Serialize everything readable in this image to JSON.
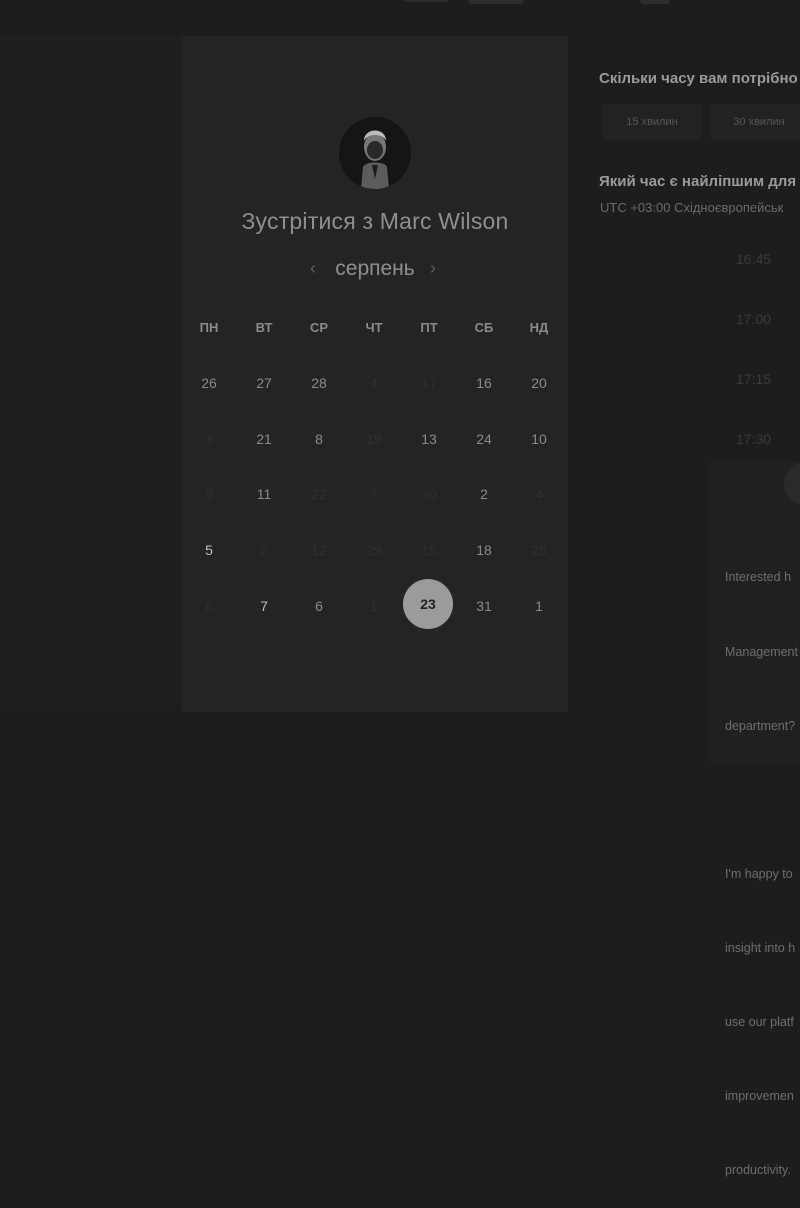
{
  "scheduler": {
    "title": "Зустрітися з Marc Wilson",
    "month": "серпень",
    "prev_arrow": "‹",
    "next_arrow": "›",
    "weekdays": [
      "ПН",
      "ВТ",
      "СР",
      "ЧТ",
      "ПТ",
      "СБ",
      "НД"
    ],
    "days": [
      [
        "26",
        "27",
        "28",
        "4",
        "17",
        "16",
        "20"
      ],
      [
        "3",
        "21",
        "8",
        "19",
        "13",
        "24",
        "10"
      ],
      [
        "9",
        "11",
        "22",
        "7",
        "30",
        "2",
        "4"
      ],
      [
        "5",
        "2",
        "12",
        "29",
        "15",
        "18",
        "25"
      ],
      [
        "6",
        "7",
        "6",
        "1",
        "23",
        "31",
        "1"
      ]
    ],
    "selected_day": "23"
  },
  "duration": {
    "heading": "Скільки часу вам потрібно",
    "options": [
      "15 хвилин",
      "30 хвилин"
    ]
  },
  "time_picker": {
    "heading": "Який час є найліпшим для",
    "timezone": "UTC +03:00 Східноєвропейськ",
    "slots": [
      "16:45",
      "17:00",
      "17:15",
      "17:30"
    ]
  },
  "info": {
    "lines": [
      "Interested h",
      "Management",
      "department?",
      "",
      "I'm happy to",
      "insight into h",
      "use our platf",
      "improvemen",
      "productivity."
    ]
  },
  "colors": {
    "background": "#1d1d1e",
    "card": "#242425",
    "selected": "#9b9b9b"
  }
}
